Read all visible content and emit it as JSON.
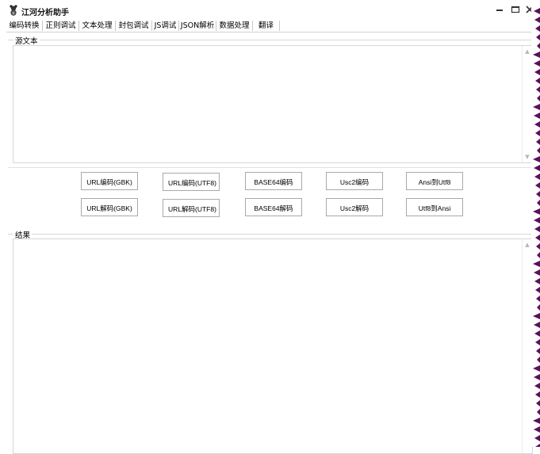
{
  "window": {
    "title": "江河分析助手",
    "icon": "bear-app-icon",
    "controls": [
      "minimize-icon",
      "maximize-icon",
      "close-icon"
    ]
  },
  "tabs": [
    {
      "label": "编码转换",
      "active": true
    },
    {
      "label": "正则调试",
      "active": false
    },
    {
      "label": "文本处理",
      "active": false
    },
    {
      "label": "封包调试",
      "active": false
    },
    {
      "label": "JS调试",
      "active": false
    },
    {
      "label": "JSON解析",
      "active": false
    },
    {
      "label": "数据处理",
      "active": false
    },
    {
      "label": "翻译",
      "active": false
    }
  ],
  "source": {
    "label": "源文本",
    "value": ""
  },
  "buttons": {
    "row1": [
      "URL编码(GBK)",
      "URL编码(UTF8)",
      "BASE64编码",
      "Usc2编码",
      "Ansi到Utf8"
    ],
    "row2": [
      "URL解码(GBK)",
      "URL解码(UTF8)",
      "BASE64解码",
      "Usc2解码",
      "Utf8到Ansi"
    ]
  },
  "result": {
    "label": "结果",
    "value": ""
  },
  "colors": {
    "background": "#ffffff",
    "border": "#d6d6d6",
    "button_border": "#a9a9a9",
    "edge_accent": "#5a1060"
  }
}
